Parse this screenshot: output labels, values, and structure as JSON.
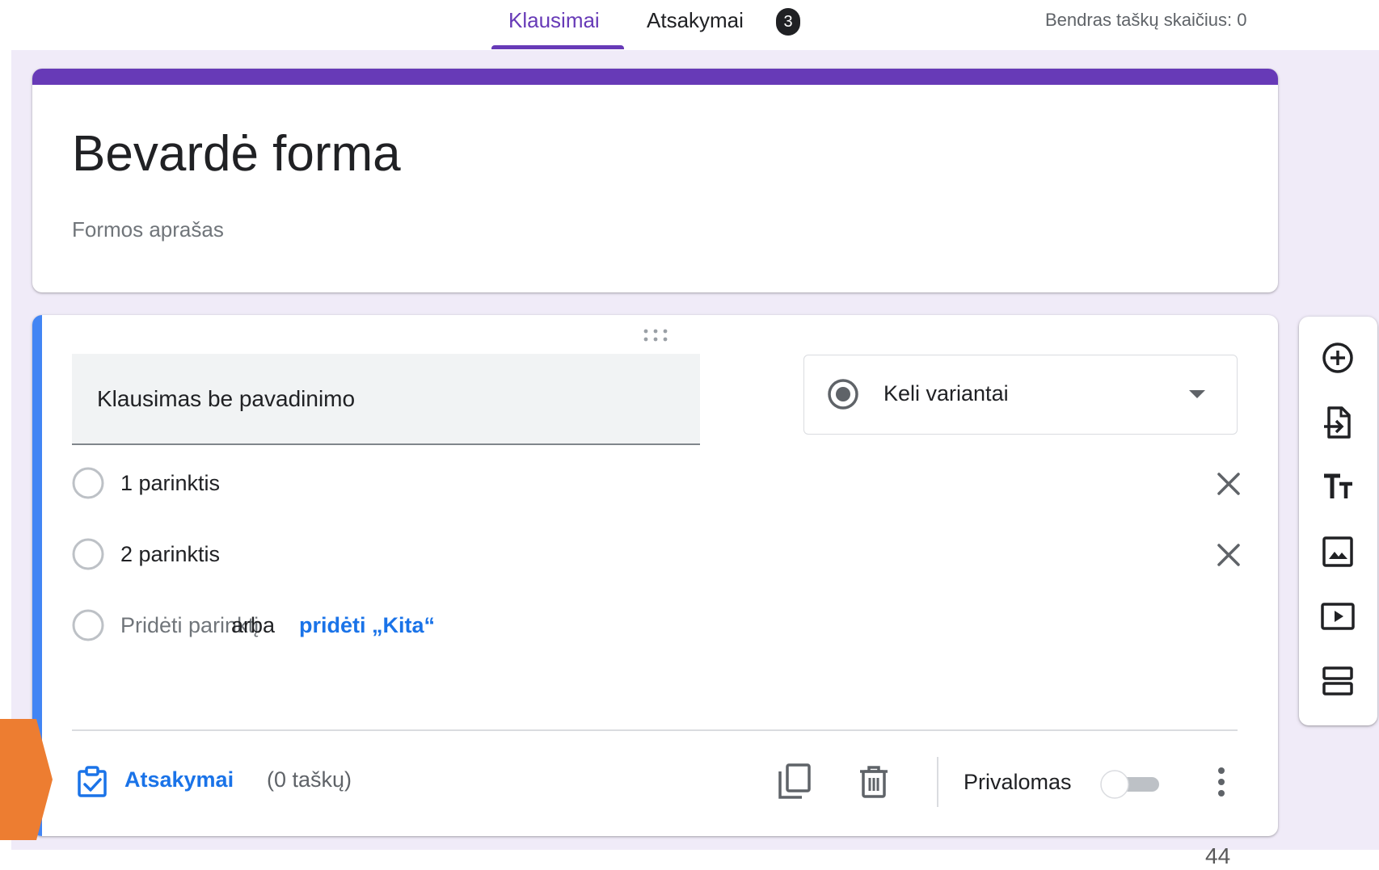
{
  "topbar": {
    "tabs": [
      {
        "label": "Klausimai",
        "active": true
      },
      {
        "label": "Atsakymai",
        "active": false,
        "badge": "3"
      }
    ],
    "total_points": "Bendras taškų skaičius: 0"
  },
  "form": {
    "title": "Bevardė forma",
    "description_placeholder": "Formos aprašas"
  },
  "question": {
    "title": "Klausimas be pavadinimo",
    "type": {
      "label": "Keli variantai",
      "icon": "radio-button-checked-icon"
    },
    "options": [
      {
        "label": "1 parinktis"
      },
      {
        "label": "2 parinktis"
      }
    ],
    "add_option": {
      "label": "Pridėti parinktį",
      "or": "arba",
      "add_other": "pridėti „Kita“"
    },
    "footer": {
      "answer_key": "Atsakymai",
      "points": "(0 taškų)",
      "required_label": "Privalomas",
      "required": false
    }
  },
  "side_toolbar": {
    "tools": [
      "add-question-icon",
      "import-questions-icon",
      "add-title-icon",
      "add-image-icon",
      "add-video-icon",
      "add-section-icon"
    ]
  },
  "slide": {
    "page_number": "44"
  },
  "colors": {
    "theme": "#673ab7",
    "background": "#f0ebf8",
    "focus": "#4285f4",
    "link": "#1a73e8",
    "callout": "#ed7d31"
  }
}
